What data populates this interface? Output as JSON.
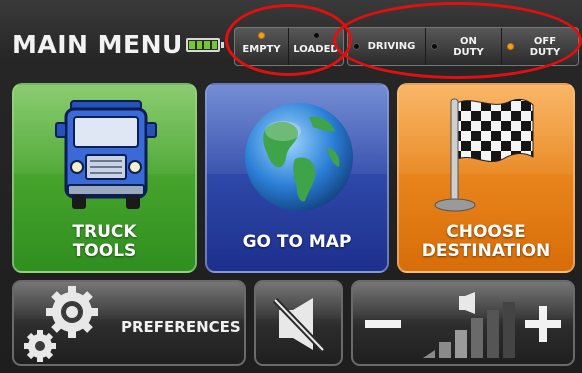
{
  "header": {
    "title": "MAIN MENU",
    "battery_icon": "battery-full-icon",
    "load_status": [
      {
        "label": "EMPTY",
        "active": true
      },
      {
        "label": "LOADED",
        "active": false
      }
    ],
    "duty_status": [
      {
        "label": "DRIVING",
        "active": false
      },
      {
        "label_line1": "ON",
        "label_line2": "DUTY",
        "active": false
      },
      {
        "label_line1": "OFF",
        "label_line2": "DUTY",
        "active": true
      }
    ]
  },
  "tiles": {
    "truck_tools": {
      "line1": "TRUCK",
      "line2": "TOOLS",
      "icon": "truck-icon",
      "color": "#4aa82d"
    },
    "go_to_map": {
      "label": "GO TO MAP",
      "icon": "globe-icon",
      "color": "#2d45a8"
    },
    "choose_destination": {
      "line1": "CHOOSE",
      "line2": "DESTINATION",
      "icon": "checkered-flag-icon",
      "color": "#f0851a"
    }
  },
  "bottom": {
    "preferences": {
      "label": "PREFERENCES",
      "icon": "gears-icon"
    },
    "mute": {
      "icon": "speaker-muted-icon"
    },
    "volume": {
      "minus_icon": "minus-icon",
      "plus_icon": "plus-icon",
      "level_icon": "volume-level-icon"
    }
  },
  "colors": {
    "active_dot": "#f0a020",
    "highlight": "#e01010"
  }
}
